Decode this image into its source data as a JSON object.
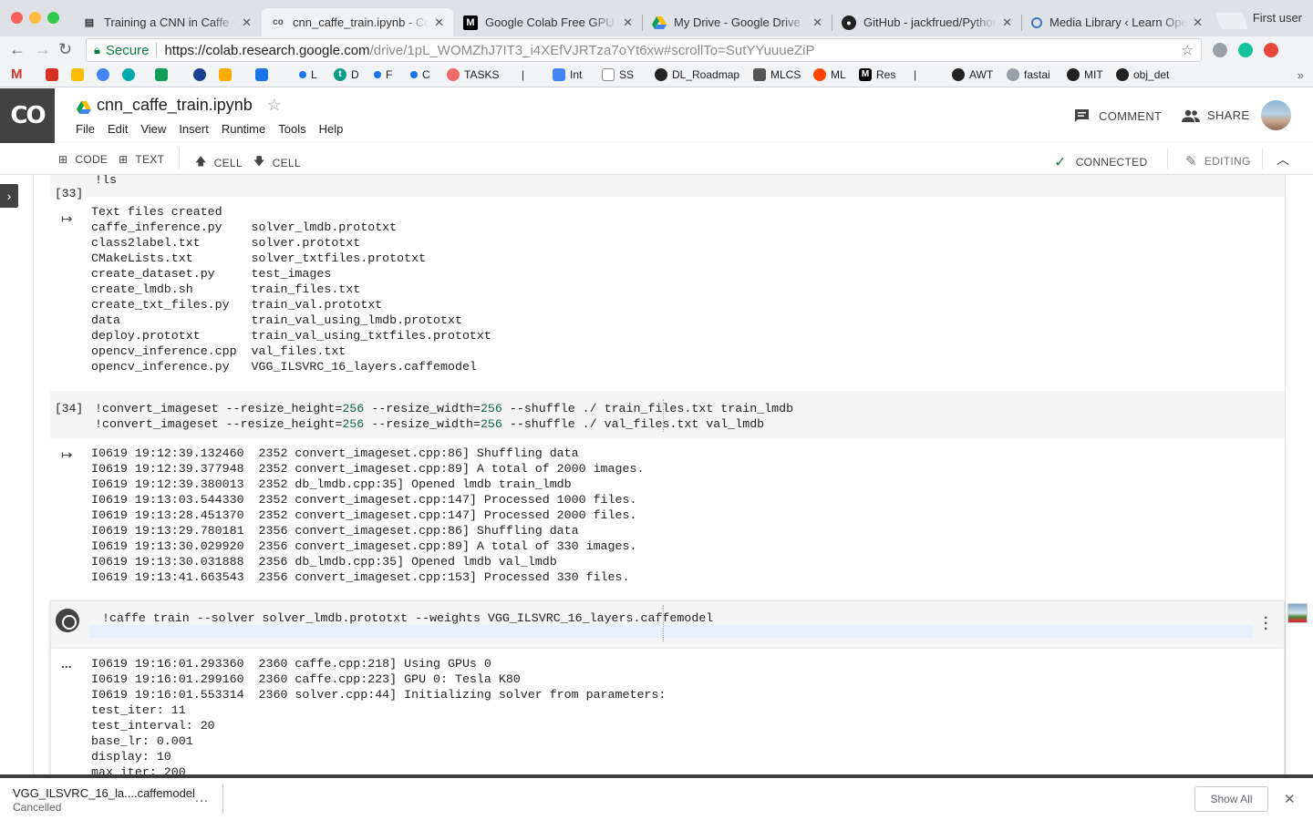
{
  "browser": {
    "tabs": [
      {
        "title": "Training a CNN in Caffe - H",
        "icon": "document-icon"
      },
      {
        "title": "cnn_caffe_train.ipynb - Cola",
        "icon": "colab-icon",
        "active": true
      },
      {
        "title": "Google Colab Free GPU Tut",
        "icon": "medium-icon"
      },
      {
        "title": "My Drive - Google Drive",
        "icon": "drive-icon"
      },
      {
        "title": "GitHub - jackfrued/Python-",
        "icon": "github-icon"
      },
      {
        "title": "Media Library ‹ Learn Open",
        "icon": "wordpress-icon"
      }
    ],
    "close_glyph": "✕",
    "profile": "First user",
    "secure_label": "Secure",
    "url_host": "https://colab.research.google.com",
    "url_path": "/drive/1pL_WOMZhJ7IT3_i4XEfVJRTza7oYt6xw#scrollTo=SutYYuuueZiP",
    "bookmarks": [
      {
        "label": "L",
        "icon": "circle-icon"
      },
      {
        "label": "D",
        "icon": "t-icon"
      },
      {
        "label": "F",
        "icon": "circle-icon"
      },
      {
        "label": "C",
        "icon": "circle-icon"
      },
      {
        "label": "TASKS",
        "icon": "asana-icon"
      },
      {
        "label": "|",
        "icon": ""
      },
      {
        "label": "Int",
        "icon": "docs-icon"
      },
      {
        "label": "SS",
        "icon": "page-icon"
      },
      {
        "label": "DL_Roadmap",
        "icon": "github-icon"
      },
      {
        "label": "MLCS",
        "icon": "grid-icon"
      },
      {
        "label": "ML",
        "icon": "reddit-icon"
      },
      {
        "label": "Res",
        "icon": "medium-icon"
      },
      {
        "label": "|",
        "icon": ""
      },
      {
        "label": "AWT",
        "icon": "github-icon"
      },
      {
        "label": "fastai",
        "icon": "forum-icon"
      },
      {
        "label": "MIT",
        "icon": "github-icon"
      },
      {
        "label": "obj_det",
        "icon": "github-icon"
      }
    ],
    "more_bookmarks": "»"
  },
  "colab": {
    "logo": "CO",
    "notebook_title": "cnn_caffe_train.ipynb",
    "menu": [
      "File",
      "Edit",
      "View",
      "Insert",
      "Runtime",
      "Tools",
      "Help"
    ],
    "comment_label": "COMMENT",
    "share_label": "SHARE",
    "toolbar": {
      "code_label": "CODE",
      "text_label": "TEXT",
      "cell_up_label": "CELL",
      "cell_down_label": "CELL",
      "connected_label": "CONNECTED",
      "editing_label": "EDITING"
    }
  },
  "cells": {
    "cell33": {
      "prompt": "[33]",
      "code": "!ls",
      "output": "Text files created\ncaffe_inference.py    solver_lmdb.prototxt\nclass2label.txt       solver.prototxt\nCMakeLists.txt        solver_txtfiles.prototxt\ncreate_dataset.py     test_images\ncreate_lmdb.sh        train_files.txt\ncreate_txt_files.py   train_val.prototxt\ndata                  train_val_using_lmdb.prototxt\ndeploy.prototxt       train_val_using_txtfiles.prototxt\nopencv_inference.cpp  val_files.txt\nopencv_inference.py   VGG_ILSVRC_16_layers.caffemodel"
    },
    "cell34": {
      "prompt": "[34]",
      "line1": {
        "a": "!convert_imageset --resize_height=",
        "n1": "256",
        "b": " --resize_width=",
        "n2": "256",
        "c": " --shuffle ./ train_files.txt train_lmdb"
      },
      "line2": {
        "a": "!convert_imageset --resize_height=",
        "n1": "256",
        "b": " --resize_width=",
        "n2": "256",
        "c": " --shuffle ./ val_files.txt val_lmdb"
      },
      "output": "I0619 19:12:39.132460  2352 convert_imageset.cpp:86] Shuffling data\nI0619 19:12:39.377948  2352 convert_imageset.cpp:89] A total of 2000 images.\nI0619 19:12:39.380013  2352 db_lmdb.cpp:35] Opened lmdb train_lmdb\nI0619 19:13:03.544330  2352 convert_imageset.cpp:147] Processed 1000 files.\nI0619 19:13:28.451370  2352 convert_imageset.cpp:147] Processed 2000 files.\nI0619 19:13:29.780181  2356 convert_imageset.cpp:86] Shuffling data\nI0619 19:13:30.029920  2356 convert_imageset.cpp:89] A total of 330 images.\nI0619 19:13:30.031888  2356 db_lmdb.cpp:35] Opened lmdb val_lmdb\nI0619 19:13:41.663543  2356 convert_imageset.cpp:153] Processed 330 files."
    },
    "cell_running": {
      "code": "!caffe train --solver solver_lmdb.prototxt --weights VGG_ILSVRC_16_layers.caffemodel",
      "running_indicator": "...",
      "output": "I0619 19:16:01.293360  2360 caffe.cpp:218] Using GPUs 0\nI0619 19:16:01.299160  2360 caffe.cpp:223] GPU 0: Tesla K80\nI0619 19:16:01.553314  2360 solver.cpp:44] Initializing solver from parameters:\ntest_iter: 11\ntest_interval: 20\nbase_lr: 0.001\ndisplay: 10\nmax_iter: 200"
    }
  },
  "downloads": {
    "file_name": "VGG_ILSVRC_16_la....caffemodel",
    "status": "Cancelled",
    "more": "…",
    "show_all": "Show All",
    "close": "✕"
  },
  "colors": {
    "accent_green": "#0b8043",
    "number_green": "#116644",
    "colab_dark": "#424242"
  }
}
